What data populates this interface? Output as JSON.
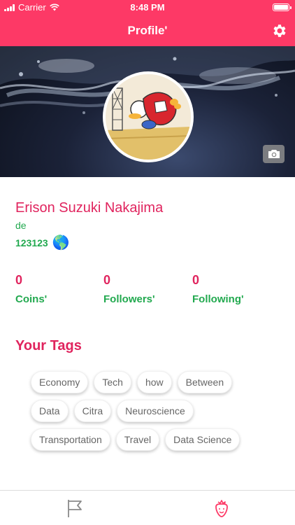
{
  "status_bar": {
    "carrier": "Carrier",
    "time": "8:48 PM"
  },
  "nav": {
    "title": "Profile'",
    "settings_icon": "gear-icon"
  },
  "cover": {
    "camera_icon": "camera-icon"
  },
  "profile": {
    "name": "Erison Suzuki Nakajima",
    "language": "de",
    "id": "123123",
    "globe": "🌎"
  },
  "stats": [
    {
      "value": "0",
      "label": "Coins'"
    },
    {
      "value": "0",
      "label": "Followers'"
    },
    {
      "value": "0",
      "label": "Following'"
    }
  ],
  "tags_section": {
    "title": "Your Tags",
    "tags": [
      "Economy",
      "Tech",
      "how",
      "Between",
      "Data",
      "Citra",
      "Neuroscience",
      "Transportation",
      "Travel",
      "Data Science"
    ]
  },
  "tab_bar": {
    "items": [
      {
        "icon": "flag-icon"
      },
      {
        "icon": "strawberry-icon"
      }
    ]
  },
  "colors": {
    "brand": "#fd3966",
    "accent_text": "#e0245e",
    "green": "#22a94f"
  }
}
